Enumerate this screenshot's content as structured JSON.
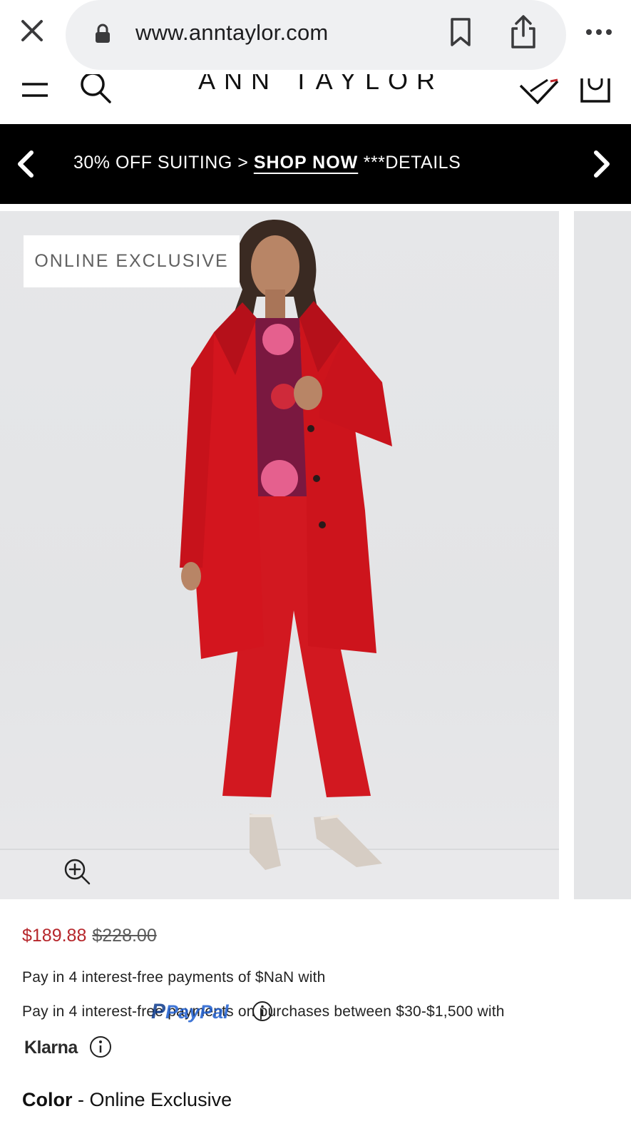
{
  "browser": {
    "url": "www.anntaylor.com",
    "icons": [
      "close-icon",
      "lock-icon",
      "bookmark-icon",
      "share-icon",
      "more-icon"
    ]
  },
  "header": {
    "brand": "ANN TAYLOR",
    "icons": [
      "menu-icon",
      "search-icon",
      "wishlist-icon",
      "bag-icon"
    ]
  },
  "promo": {
    "text": "30% OFF SUITING > ",
    "link": "SHOP NOW",
    "details": " ***DETAILS"
  },
  "product": {
    "badge": "ONLINE EXCLUSIVE",
    "sale_price": "$189.88",
    "original_price": "$228.00",
    "paypal_text": "Pay in 4 interest-free payments of $NaN with",
    "paypal_logo": "PayPal",
    "klarna_text": "Pay in 4 interest-free payments on purchases between $30-$1,500 with",
    "klarna_logo": "Klarna",
    "color_label": "Color",
    "color_separator": " - ",
    "color_value": "Online Exclusive"
  },
  "colors": {
    "sale_price": "#b6262b",
    "promo_bg": "#000000",
    "coat": "#d3151e",
    "url_bar": "#eff0f2"
  }
}
